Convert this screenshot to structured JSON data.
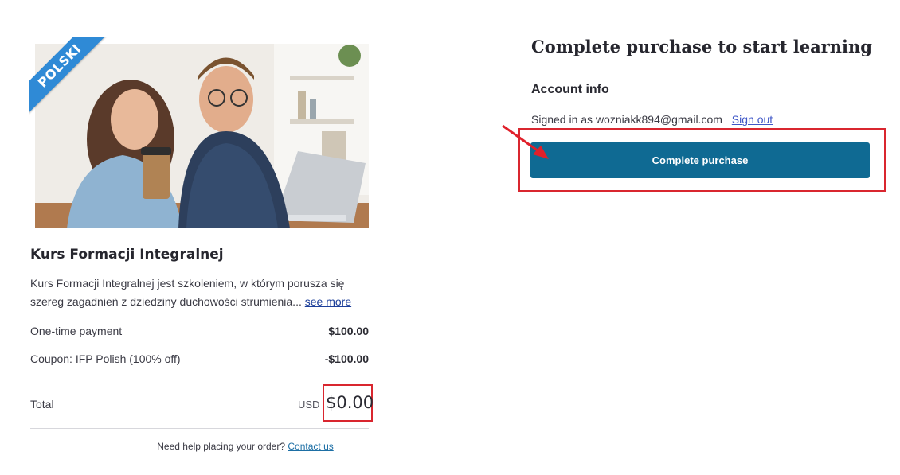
{
  "course": {
    "badge": "POLSKI",
    "title": "Kurs Formacji Integralnej",
    "description": "Kurs Formacji Integralnej jest szkoleniem, w którym porusza się szereg zagadnień z dziedziny duchowości strumienia...",
    "see_more": "see more"
  },
  "summary": {
    "payment_label": "One-time payment",
    "payment_value": "$100.00",
    "coupon_label": "Coupon: IFP Polish (100% off)",
    "coupon_value": "-$100.00",
    "total_label": "Total",
    "currency": "USD",
    "total_value": "$0.00"
  },
  "help": {
    "text": "Need help placing your order?",
    "link": "Contact us"
  },
  "checkout": {
    "headline": "Complete purchase to start learning",
    "account_title": "Account info",
    "signed_in_text": "Signed in as wozniakk894@gmail.com",
    "sign_out": "Sign out",
    "button_label": "Complete purchase"
  },
  "colors": {
    "button": "#0f6a93",
    "highlight": "#d9262f",
    "ribbon": "#2f8ad6"
  }
}
